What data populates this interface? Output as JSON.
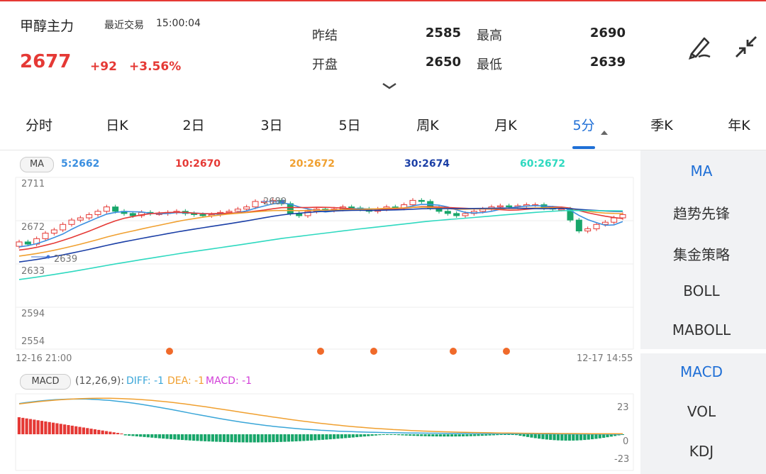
{
  "header": {
    "name": "甲醇主力",
    "recent_label": "最近交易",
    "time": "15:00:04",
    "price": "2677",
    "change": "+92",
    "change_pct": "+3.56%",
    "quotes": [
      {
        "label": "昨结",
        "value": "2585"
      },
      {
        "label": "最高",
        "value": "2690"
      },
      {
        "label": "开盘",
        "value": "2650"
      },
      {
        "label": "最低",
        "value": "2639"
      }
    ],
    "icons": [
      "draw-pen-icon",
      "collapse-arrows-icon"
    ]
  },
  "tabs": [
    {
      "label": "分时",
      "active": false
    },
    {
      "label": "日K",
      "active": false
    },
    {
      "label": "2日",
      "active": false
    },
    {
      "label": "3日",
      "active": false
    },
    {
      "label": "5日",
      "active": false
    },
    {
      "label": "周K",
      "active": false
    },
    {
      "label": "月K",
      "active": false
    },
    {
      "label": "5分",
      "active": true
    },
    {
      "label": "季K",
      "active": false
    },
    {
      "label": "年K",
      "active": false
    }
  ],
  "ma": {
    "pill": "MA",
    "items": [
      {
        "text": "5:2662",
        "color": "#3b8fe0"
      },
      {
        "text": "10:2670",
        "color": "#e53935"
      },
      {
        "text": "20:2672",
        "color": "#f0a030"
      },
      {
        "text": "30:2674",
        "color": "#1b3fa6"
      },
      {
        "text": "60:2672",
        "color": "#2fd9c0"
      }
    ]
  },
  "price_axis": [
    "2711",
    "2672",
    "2633",
    "2594",
    "2554"
  ],
  "annotations": {
    "high": "2689",
    "low": "2639"
  },
  "time_axis": {
    "start": "12-16 21:00",
    "end": "12-17 14:55"
  },
  "macd": {
    "pill": "MACD",
    "params": "(12,26,9):",
    "items": [
      {
        "text": "DIFF: -1",
        "color": "#3aa6d8"
      },
      {
        "text": "DEA: -1",
        "color": "#f0a030"
      },
      {
        "text": "MACD: -1",
        "color": "#d23fd8"
      }
    ],
    "axis": [
      "23",
      "0",
      "-23"
    ]
  },
  "side_panel": {
    "main": [
      {
        "label": "MA",
        "active": true
      },
      {
        "label": "趋势先锋",
        "active": false
      },
      {
        "label": "集金策略",
        "active": false
      },
      {
        "label": "BOLL",
        "active": false
      },
      {
        "label": "MABOLL",
        "active": false
      }
    ],
    "sub": [
      {
        "label": "MACD",
        "active": true
      },
      {
        "label": "VOL",
        "active": false
      },
      {
        "label": "KDJ",
        "active": false
      }
    ]
  },
  "colors": {
    "up": "#e53935",
    "down": "#18a66a",
    "accent": "#1f6fd6"
  },
  "chart_data": {
    "type": "candlestick",
    "ylim": [
      2554,
      2711
    ],
    "candles_close": [
      2652,
      2650,
      2655,
      2660,
      2663,
      2668,
      2672,
      2674,
      2677,
      2680,
      2684,
      2680,
      2678,
      2676,
      2679,
      2678,
      2678,
      2679,
      2680,
      2678,
      2677,
      2676,
      2677,
      2679,
      2680,
      2682,
      2684,
      2689,
      2689,
      2690,
      2687,
      2678,
      2676,
      2680,
      2682,
      2681,
      2682,
      2684,
      2683,
      2682,
      2680,
      2682,
      2684,
      2683,
      2686,
      2690,
      2689,
      2683,
      2680,
      2678,
      2676,
      2678,
      2680,
      2682,
      2684,
      2685,
      2684,
      2685,
      2686,
      2686,
      2683,
      2682,
      2682,
      2672,
      2662,
      2664,
      2668,
      2670,
      2674,
      2677
    ],
    "macd_hist_note": "positive at start, negative remainder, near zero at end"
  }
}
